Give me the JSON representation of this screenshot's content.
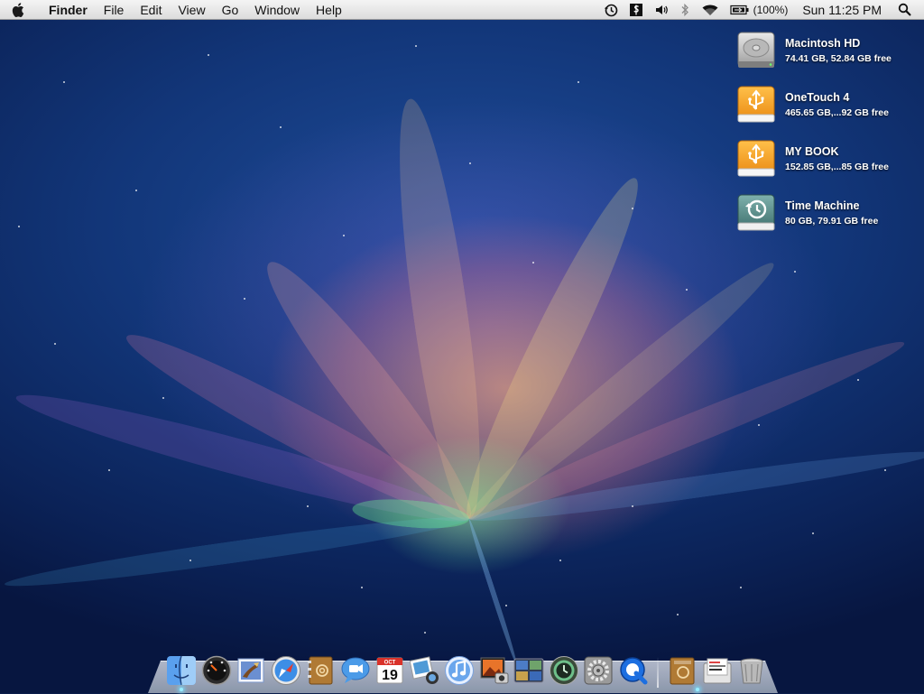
{
  "menubar": {
    "apple_icon": "apple-logo-icon",
    "menus": [
      {
        "label": "Finder",
        "active_app": true
      },
      {
        "label": "File"
      },
      {
        "label": "Edit"
      },
      {
        "label": "View"
      },
      {
        "label": "Go"
      },
      {
        "label": "Window"
      },
      {
        "label": "Help"
      }
    ],
    "extras": {
      "time_machine_icon": "time-machine-icon",
      "script_icon": "script-menu-icon",
      "volume_icon": "volume-icon",
      "bluetooth_icon": "bluetooth-icon",
      "wifi_icon": "wifi-icon",
      "battery_icon": "battery-charging-icon",
      "battery_percent": "(100%)",
      "clock": "Sun 11:25 PM",
      "spotlight_icon": "spotlight-search-icon"
    }
  },
  "desktop": {
    "volumes": [
      {
        "name": "Macintosh HD",
        "info": "74.41 GB, 52.84 GB free",
        "icon": "hard-drive-icon"
      },
      {
        "name": "OneTouch 4",
        "info": "465.65 GB,...92 GB free",
        "icon": "usb-drive-icon"
      },
      {
        "name": "MY BOOK",
        "info": "152.85 GB,...85 GB free",
        "icon": "usb-drive-icon"
      },
      {
        "name": "Time Machine",
        "info": "80 GB, 79.91 GB free",
        "icon": "time-machine-drive-icon"
      }
    ]
  },
  "dock": {
    "apps": [
      "Finder",
      "Dashboard",
      "Mail",
      "Safari",
      "Address Book",
      "iChat",
      "iCal",
      "iPhoto",
      "iTunes",
      "Photo Booth",
      "Spaces",
      "Time Machine",
      "System Preferences",
      "QuickTime Player"
    ],
    "calendar_day": "19",
    "calendar_month": "OCT",
    "others": [
      "Applications Stack",
      "Documents Stack",
      "Trash"
    ]
  },
  "colors": {
    "menubar_bg": "#e6e6e6",
    "desktop_bg": "#123679",
    "usb_drive": "#f39a1e",
    "time_machine_drive": "#5a8f8c",
    "running_light": "#9eeeff"
  }
}
